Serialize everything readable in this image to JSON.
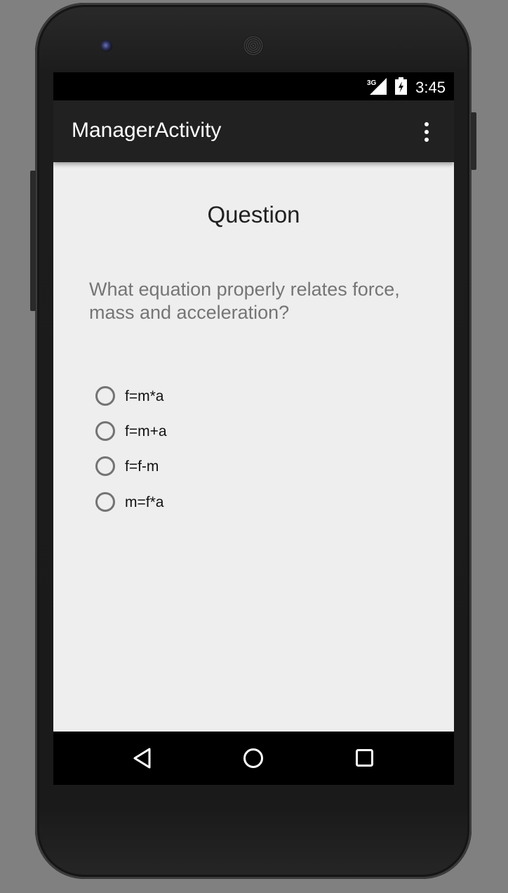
{
  "status_bar": {
    "network": "3G",
    "time": "3:45"
  },
  "action_bar": {
    "title": "ManagerActivity",
    "overflow_icon": "more-vert-icon"
  },
  "content": {
    "heading": "Question",
    "question": "What equation properly relates force, mass and acceleration?",
    "answers": [
      {
        "label": "f=m*a",
        "selected": false
      },
      {
        "label": "f=m+a",
        "selected": false
      },
      {
        "label": "f=f-m",
        "selected": false
      },
      {
        "label": "m=f*a",
        "selected": false
      }
    ]
  },
  "nav_bar": {
    "back_icon": "back-triangle-icon",
    "home_icon": "home-circle-icon",
    "recents_icon": "recents-square-icon"
  },
  "colors": {
    "status_bar": "#000000",
    "action_bar": "#212121",
    "background": "#eeeeee",
    "heading_text": "#212121",
    "question_text": "#757575",
    "radio_border": "#737373"
  }
}
